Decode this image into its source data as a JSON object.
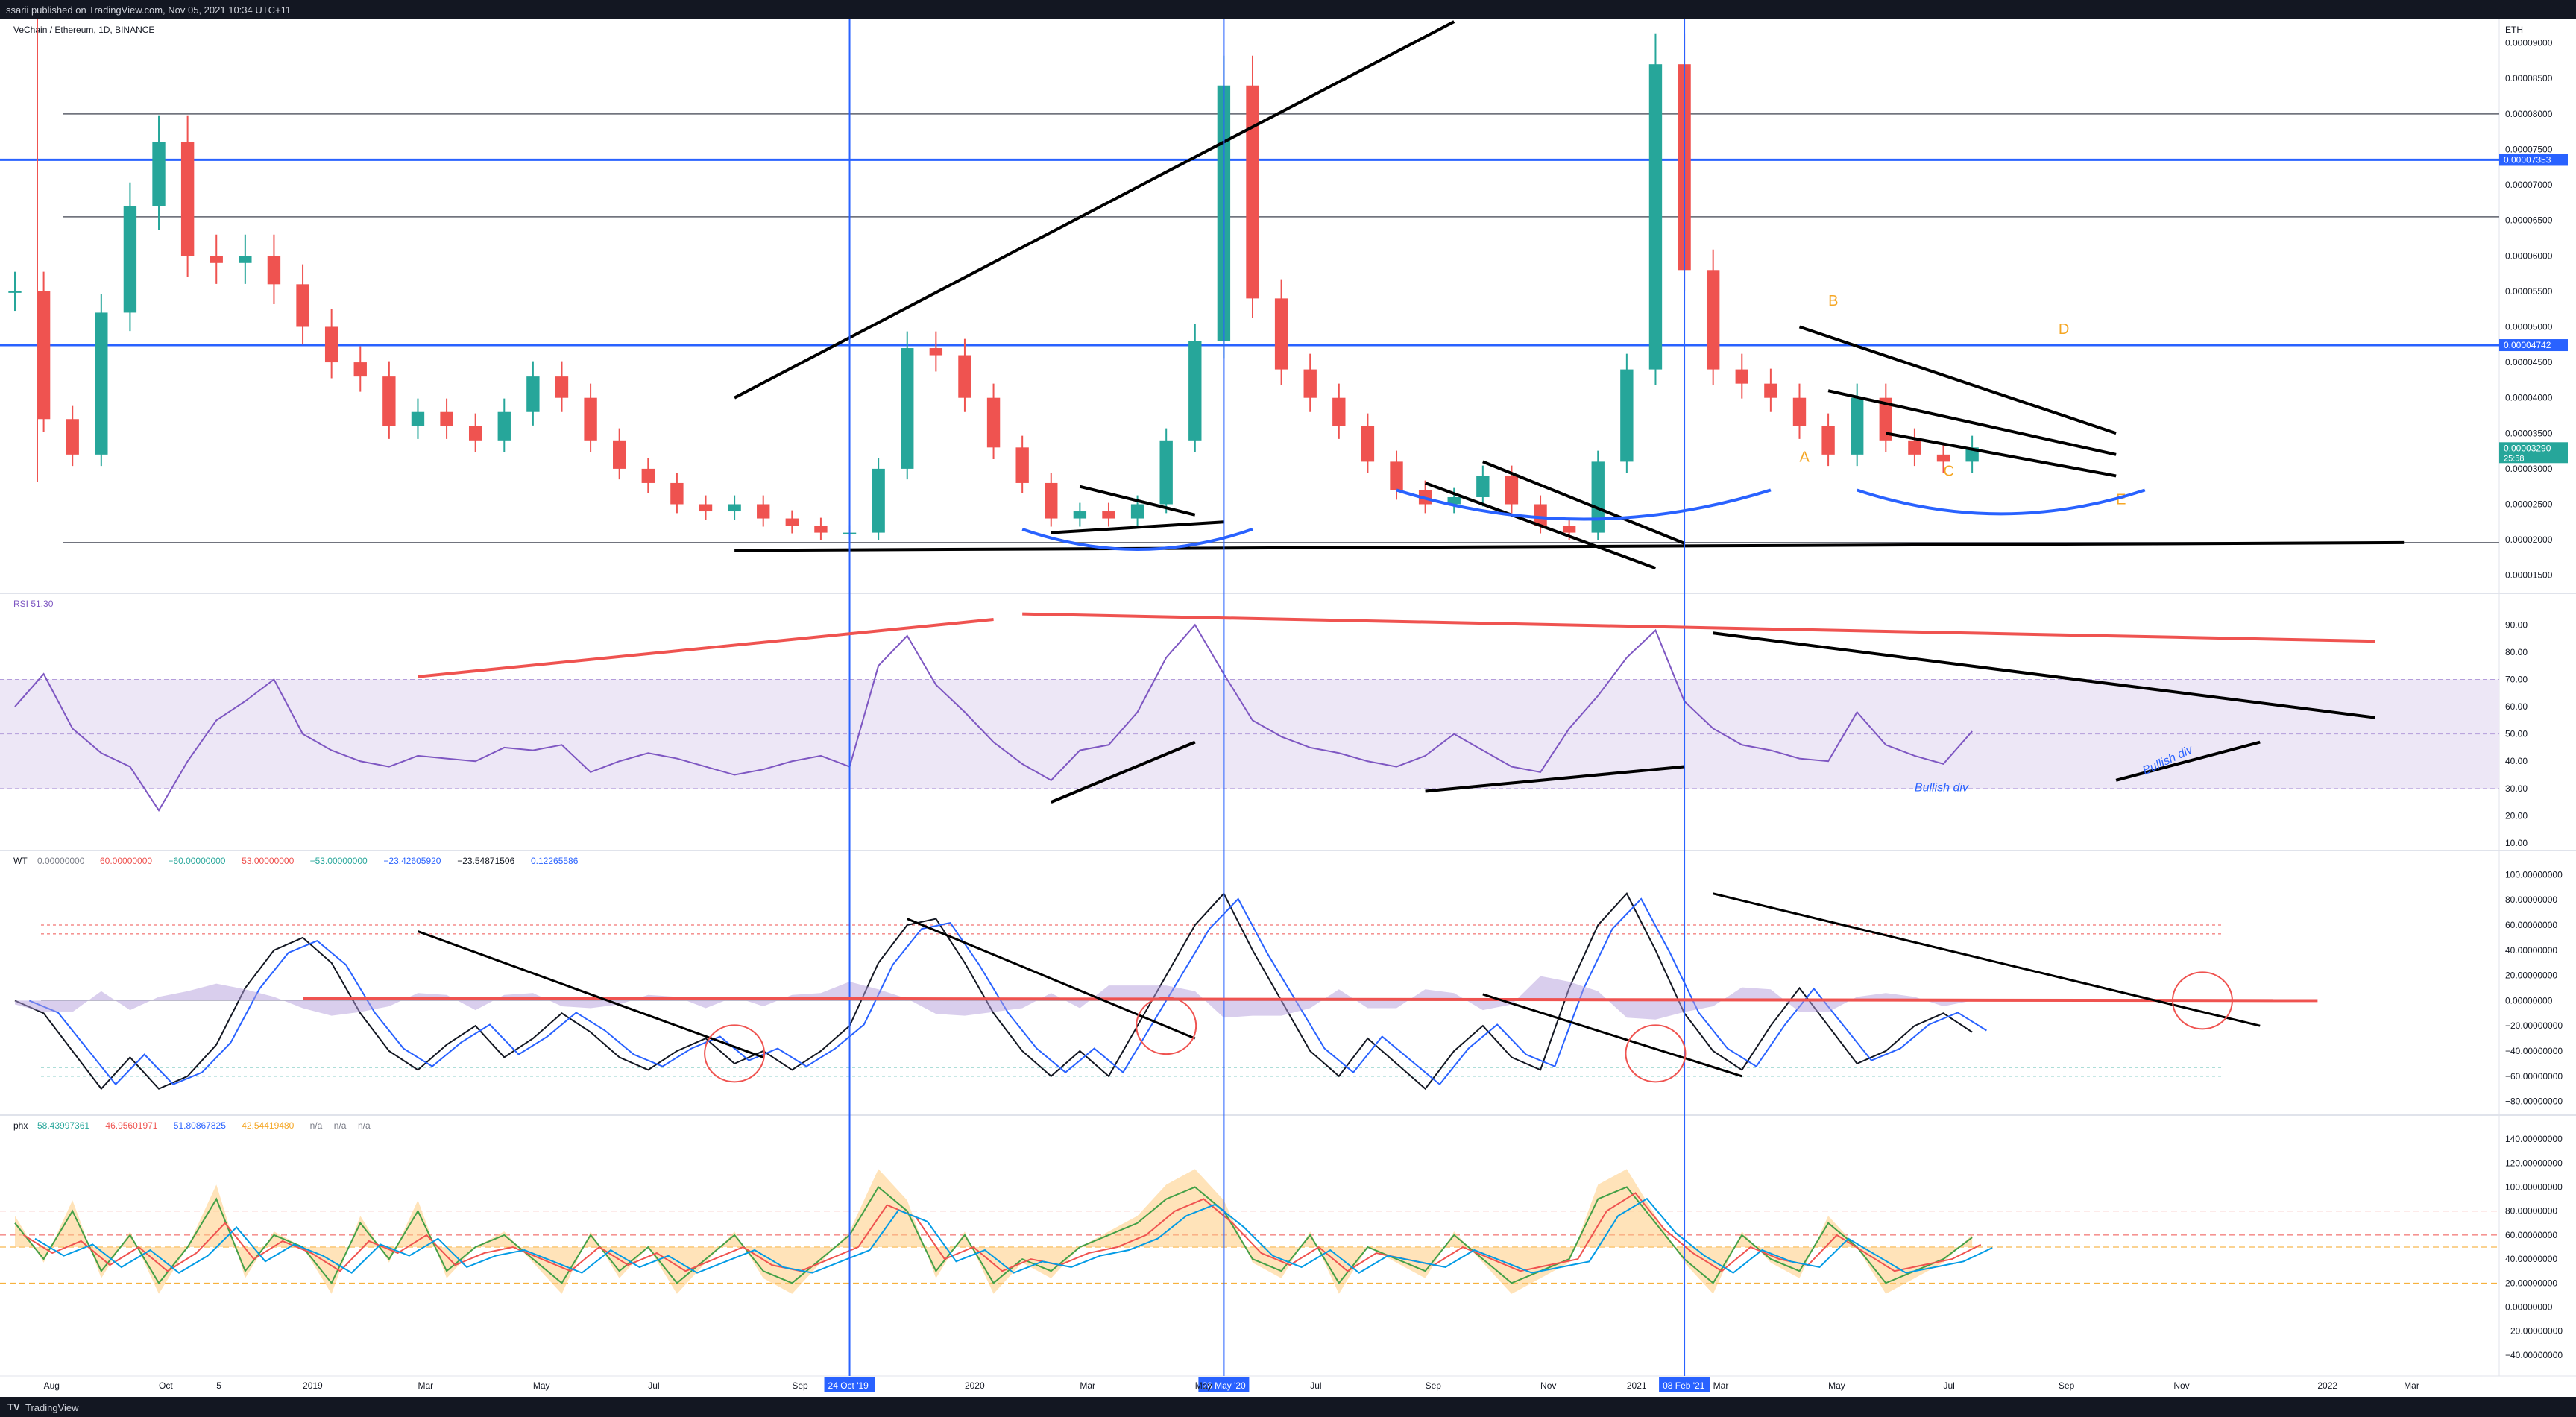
{
  "header": {
    "published": "ssarii published on TradingView.com, Nov 05, 2021 10:34 UTC+11"
  },
  "footer": {
    "logo": "TV",
    "brand": "TradingView"
  },
  "colors": {
    "up": "#26a69a",
    "down": "#ef5350",
    "blue": "#2962ff",
    "rsi": "#7e57c2",
    "accent_orange": "#f5a623"
  },
  "chart_data": [
    {
      "type": "candlestick",
      "title": "VeChain / Ethereum, 1D, BINANCE",
      "currency": "ETH",
      "price_axis": [
        "0.00009000",
        "0.00008500",
        "0.00008000",
        "0.00007500",
        "0.00007000",
        "0.00006500",
        "0.00006000",
        "0.00005500",
        "0.00005000",
        "0.00004500",
        "0.00004000",
        "0.00003500",
        "0.00003000",
        "0.00002500",
        "0.00002000",
        "0.00001500"
      ],
      "ylim": [
        1.35e-05,
        9.08e-05
      ],
      "price_labels": [
        {
          "value": 7.353e-05,
          "text": "0.00007353",
          "color": "#2962ff"
        },
        {
          "value": 4.742e-05,
          "text": "0.00004742",
          "color": "#2962ff"
        },
        {
          "value": 3.29e-05,
          "text": "0.00003290",
          "sub": "25:58",
          "color": "#26a69a"
        }
      ],
      "horizontal_levels": [
        {
          "value": 7.353e-05,
          "style": "blue"
        },
        {
          "value": 4.742e-05,
          "style": "blue"
        },
        {
          "value": 8e-05,
          "style": "gray"
        },
        {
          "value": 6.55e-05,
          "style": "gray"
        },
        {
          "value": 1.96e-05,
          "style": "gray"
        }
      ],
      "pattern_labels": [
        "A",
        "B",
        "C",
        "D",
        "E"
      ],
      "close_series": [
        5.5e-05,
        3.7e-05,
        3.2e-05,
        5.2e-05,
        6.7e-05,
        7.6e-05,
        6e-05,
        5.9e-05,
        6e-05,
        5.6e-05,
        5e-05,
        4.5e-05,
        4.3e-05,
        3.6e-05,
        3.8e-05,
        3.6e-05,
        3.4e-05,
        3.8e-05,
        4.3e-05,
        4e-05,
        3.4e-05,
        3e-05,
        2.8e-05,
        2.5e-05,
        2.4e-05,
        2.5e-05,
        2.3e-05,
        2.2e-05,
        2.1e-05,
        2.1e-05,
        3e-05,
        4.7e-05,
        4.6e-05,
        4e-05,
        3.3e-05,
        2.8e-05,
        2.3e-05,
        2.4e-05,
        2.3e-05,
        2.5e-05,
        3.4e-05,
        4.8e-05,
        8.4e-05,
        5.4e-05,
        4.4e-05,
        4e-05,
        3.6e-05,
        3.1e-05,
        2.7e-05,
        2.5e-05,
        2.6e-05,
        2.9e-05,
        2.5e-05,
        2.2e-05,
        2.1e-05,
        3.1e-05,
        4.4e-05,
        8.7e-05,
        5.8e-05,
        4.4e-05,
        4.2e-05,
        4e-05,
        3.6e-05,
        3.2e-05,
        4e-05,
        3.4e-05,
        3.2e-05,
        3.1e-05,
        3.3e-05
      ]
    },
    {
      "type": "line",
      "title": "RSI",
      "value_label": "51.30",
      "axis": [
        "90.00",
        "80.00",
        "70.00",
        "60.00",
        "50.00",
        "40.00",
        "30.00",
        "20.00",
        "10.00"
      ],
      "ylim": [
        10,
        95
      ],
      "band": [
        30,
        70
      ],
      "annotations": [
        "Bullish div",
        "Bullish div"
      ],
      "series": [
        {
          "values": [
            60,
            72,
            52,
            43,
            38,
            22,
            40,
            55,
            62,
            70,
            50,
            44,
            40,
            38,
            42,
            41,
            40,
            45,
            44,
            46,
            36,
            40,
            43,
            41,
            38,
            35,
            37,
            40,
            42,
            38,
            75,
            86,
            68,
            58,
            47,
            39,
            33,
            44,
            46,
            58,
            78,
            90,
            72,
            55,
            49,
            45,
            43,
            40,
            38,
            42,
            50,
            44,
            38,
            36,
            52,
            64,
            78,
            88,
            62,
            52,
            46,
            44,
            41,
            40,
            58,
            46,
            42,
            39,
            51
          ]
        }
      ]
    },
    {
      "type": "line",
      "title": "WT",
      "header_values": [
        "0.00000000",
        "60.00000000",
        "−60.00000000",
        "53.00000000",
        "−53.00000000",
        "−23.42605920",
        "−23.54871506",
        "0.12265586"
      ],
      "axis": [
        "100.00000000",
        "80.00000000",
        "60.00000000",
        "40.00000000",
        "20.00000000",
        "0.00000000",
        "−20.00000000",
        "−40.00000000",
        "−60.00000000",
        "−80.00000000"
      ],
      "ylim": [
        -85,
        105
      ],
      "levels": [
        60,
        53,
        0,
        -53,
        -60
      ],
      "series": [
        {
          "name": "WT1",
          "values": [
            0,
            -10,
            -40,
            -70,
            -45,
            -70,
            -60,
            -35,
            10,
            40,
            50,
            30,
            -10,
            -40,
            -55,
            -35,
            -20,
            -45,
            -30,
            -10,
            -25,
            -45,
            -55,
            -40,
            -30,
            -50,
            -40,
            -55,
            -40,
            -20,
            30,
            60,
            65,
            30,
            -10,
            -40,
            -60,
            -40,
            -60,
            -20,
            20,
            60,
            85,
            40,
            0,
            -40,
            -60,
            -30,
            -50,
            -70,
            -40,
            -20,
            -45,
            -55,
            10,
            60,
            85,
            40,
            -10,
            -40,
            -55,
            -20,
            10,
            -20,
            -50,
            -40,
            -20,
            -10,
            -25
          ]
        }
      ]
    },
    {
      "type": "line",
      "title": "phx",
      "header_values": [
        "58.43997361",
        "46.95601971",
        "51.80867825",
        "42.54419480",
        "n/a",
        "n/a",
        "n/a"
      ],
      "axis": [
        "140.00000000",
        "120.00000000",
        "100.00000000",
        "80.00000000",
        "60.00000000",
        "40.00000000",
        "20.00000000",
        "0.00000000",
        "−20.00000000",
        "−40.00000000"
      ],
      "ylim": [
        -45,
        145
      ],
      "levels": [
        80,
        60,
        50,
        20
      ],
      "series": [
        {
          "values": [
            70,
            40,
            80,
            30,
            60,
            20,
            50,
            90,
            30,
            60,
            50,
            20,
            70,
            40,
            80,
            30,
            50,
            60,
            40,
            20,
            60,
            30,
            50,
            20,
            40,
            60,
            30,
            20,
            40,
            60,
            100,
            80,
            30,
            60,
            20,
            40,
            30,
            50,
            60,
            70,
            90,
            100,
            80,
            40,
            30,
            60,
            20,
            50,
            40,
            30,
            60,
            40,
            20,
            30,
            40,
            90,
            100,
            70,
            40,
            20,
            60,
            40,
            30,
            70,
            50,
            20,
            30,
            40,
            58
          ]
        },
        {
          "values": [
            60,
            45,
            55,
            35,
            50,
            30,
            45,
            70,
            40,
            55,
            45,
            30,
            55,
            45,
            60,
            35,
            45,
            50,
            40,
            30,
            50,
            35,
            45,
            30,
            40,
            50,
            35,
            30,
            40,
            50,
            85,
            75,
            40,
            50,
            30,
            40,
            35,
            45,
            50,
            60,
            80,
            90,
            70,
            45,
            35,
            50,
            30,
            45,
            40,
            35,
            50,
            40,
            30,
            35,
            40,
            80,
            95,
            65,
            45,
            30,
            50,
            40,
            35,
            60,
            45,
            30,
            35,
            40,
            52
          ]
        }
      ]
    }
  ],
  "time_axis": [
    {
      "label": "Aug",
      "i": 1
    },
    {
      "label": "Oct",
      "i": 5
    },
    {
      "label": "5",
      "i": 7
    },
    {
      "label": "2019",
      "i": 10
    },
    {
      "label": "Mar",
      "i": 14
    },
    {
      "label": "May",
      "i": 18
    },
    {
      "label": "Jul",
      "i": 22
    },
    {
      "label": "Sep",
      "i": 27
    },
    {
      "label": "2020",
      "i": 33
    },
    {
      "label": "Mar",
      "i": 37
    },
    {
      "label": "May",
      "i": 41
    },
    {
      "label": "Jul",
      "i": 45
    },
    {
      "label": "Sep",
      "i": 49
    },
    {
      "label": "Nov",
      "i": 53
    },
    {
      "label": "2021",
      "i": 56
    },
    {
      "label": "Mar",
      "i": 59
    },
    {
      "label": "May",
      "i": 63
    },
    {
      "label": "Jul",
      "i": 67
    },
    {
      "label": "Sep",
      "i": 71
    },
    {
      "label": "Nov",
      "i": 75
    },
    {
      "label": "2022",
      "i": 80
    },
    {
      "label": "Mar",
      "i": 83
    }
  ],
  "date_markers": [
    {
      "label": "24 Oct '19",
      "i": 29
    },
    {
      "label": "26 May '20",
      "i": 42
    },
    {
      "label": "08 Feb '21",
      "i": 58
    }
  ]
}
